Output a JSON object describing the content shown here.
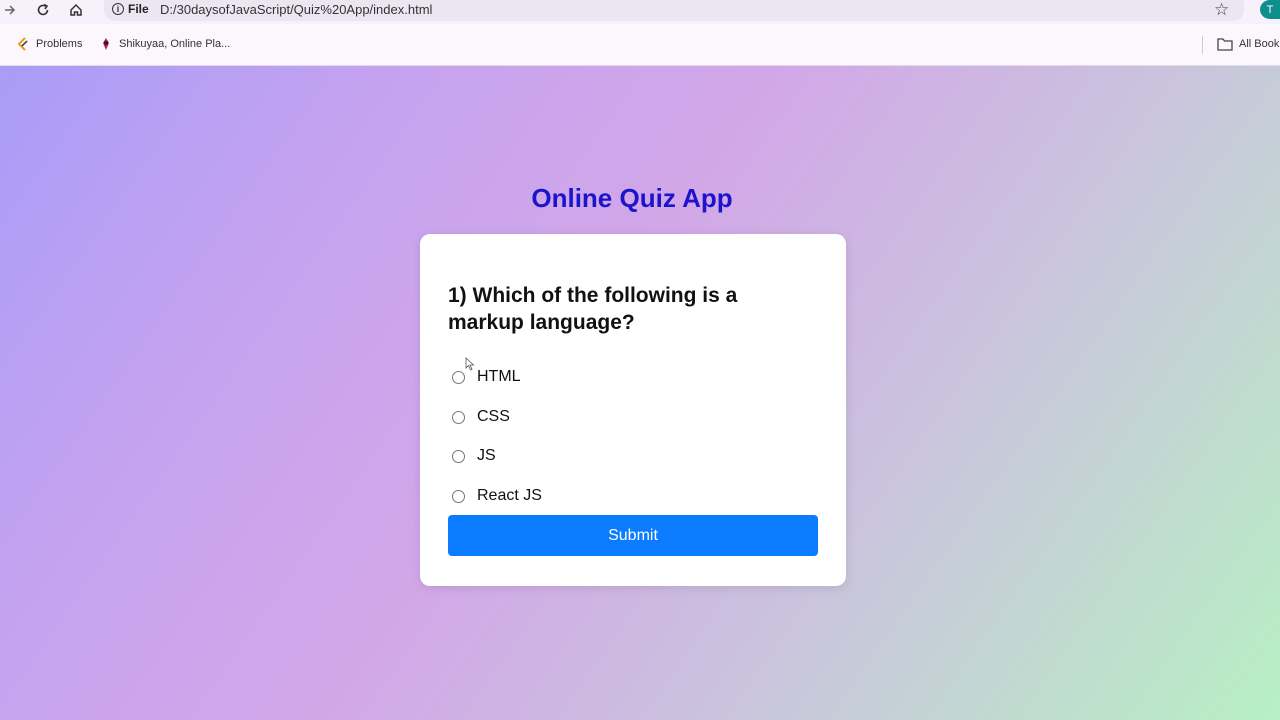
{
  "browser": {
    "address_scheme": "File",
    "url": "D:/30daysofJavaScript/Quiz%20App/index.html",
    "profile_initial": "T",
    "bookmarks": [
      {
        "label": "Problems"
      },
      {
        "label": "Shikuyaa, Online Pla..."
      }
    ],
    "all_bookmarks_label": "All Book"
  },
  "app": {
    "title": "Online Quiz App",
    "question": "1) Which of the following is a markup language?",
    "options": [
      "HTML",
      "CSS",
      "JS",
      "React JS"
    ],
    "submit_label": "Submit"
  },
  "colors": {
    "title": "#1c14cc",
    "submit_button": "#0b7cff",
    "gradient_start": "#a99cf7",
    "gradient_end": "#b7f0c3"
  },
  "icons": [
    "back-arrow-icon",
    "reload-icon",
    "home-icon",
    "info-icon",
    "star-icon",
    "folder-icon"
  ]
}
